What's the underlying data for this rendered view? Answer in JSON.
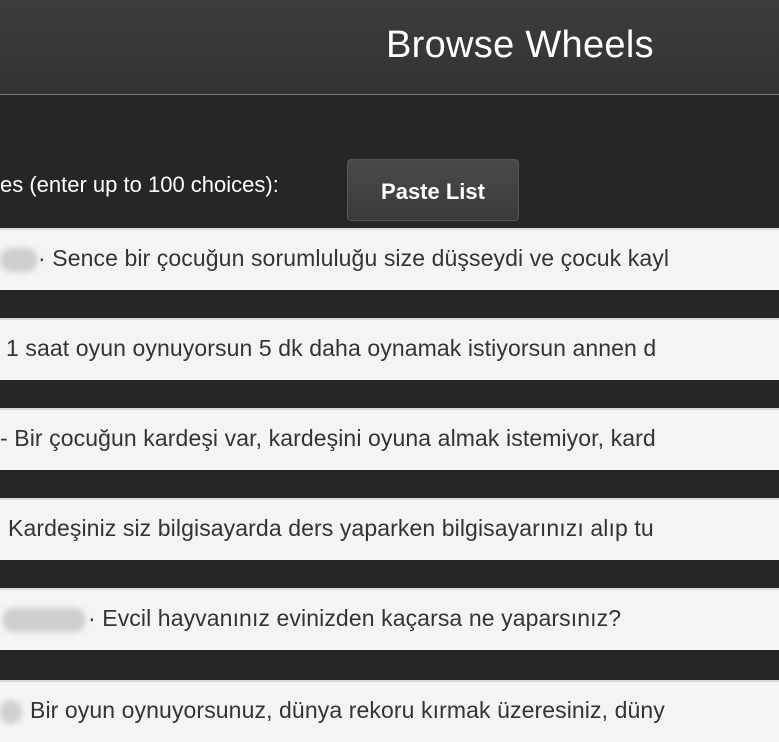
{
  "header": {
    "title": "Browse Wheels"
  },
  "choices": {
    "label": "es (enter up to 100 choices):",
    "paste_button": "Paste List",
    "items": [
      "· Sence bir çocuğun sorumluluğu size düşseydi ve çocuk kayl",
      "1 saat oyun oynuyorsun 5 dk daha oynamak istiyorsun annen d",
      "- Bir çocuğun kardeşi var, kardeşini oyuna almak istemiyor, kard",
      "Kardeşiniz siz bilgisayarda ders yaparken bilgisayarınızı alıp tu",
      "· Evcil hayvanınız evinizden kaçarsa ne yaparsınız?",
      "Bir oyun oynuyorsunuz, dünya rekoru kırmak üzeresiniz, düny"
    ]
  }
}
